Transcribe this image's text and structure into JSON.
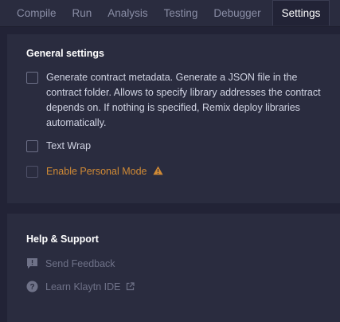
{
  "tabs": [
    {
      "label": "Compile",
      "active": false
    },
    {
      "label": "Run",
      "active": false
    },
    {
      "label": "Analysis",
      "active": false
    },
    {
      "label": "Testing",
      "active": false
    },
    {
      "label": "Debugger",
      "active": false
    },
    {
      "label": "Settings",
      "active": true
    }
  ],
  "general": {
    "title": "General settings",
    "options": [
      {
        "label": "Generate contract metadata. Generate a JSON file in the contract folder. Allows to specify library addresses the contract depends on. If nothing is specified, Remix deploy libraries automatically.",
        "checked": false
      },
      {
        "label": "Text Wrap",
        "checked": false
      },
      {
        "label": "Enable Personal Mode",
        "checked": false,
        "icon": "warning-icon"
      }
    ]
  },
  "help": {
    "title": "Help & Support",
    "items": [
      {
        "label": "Send Feedback",
        "icon": "feedback-icon"
      },
      {
        "label": "Learn Klaytn IDE",
        "icon": "help-circle-icon",
        "trailing_icon": "external-link-icon"
      }
    ]
  },
  "colors": {
    "background": "#222336",
    "panel": "#2a2c3f",
    "accent_warning": "#d08a35",
    "text_primary": "#ffffff",
    "text_muted": "#6f7288"
  }
}
